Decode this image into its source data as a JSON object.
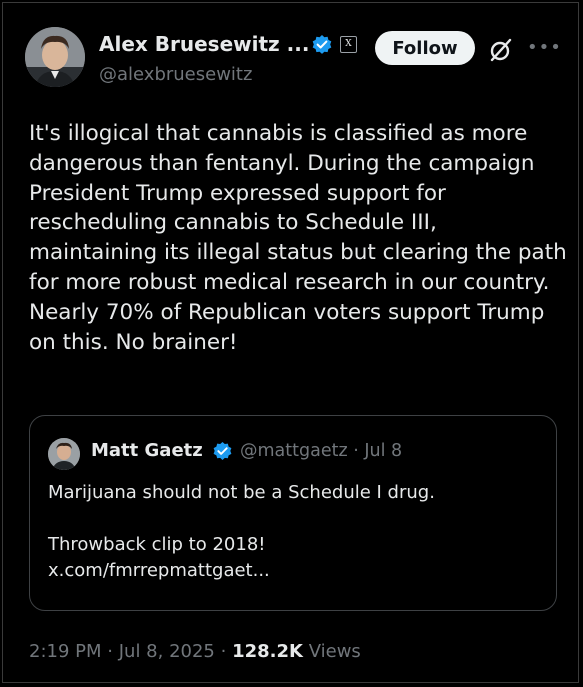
{
  "author": {
    "name": "Alex Bruesewitz ...",
    "handle": "@alexbruesewitz",
    "affiliate_badge": "X"
  },
  "actions": {
    "follow_label": "Follow",
    "more_label": "•••"
  },
  "post": {
    "text": "It's illogical that cannabis is classified as more dangerous than fentanyl. During the campaign President Trump expressed support for rescheduling cannabis to Schedule III, maintaining its illegal status but clearing the path for more robust medical research in our country. Nearly 70% of Republican voters support Trump on this. No brainer!"
  },
  "quote": {
    "name": "Matt Gaetz",
    "handle": "@mattgaetz",
    "separator": "·",
    "date": "Jul 8",
    "line1": "Marijuana should not be a Schedule I drug.",
    "line2": "Throwback clip to 2018!",
    "link": "x.com/fmrrepmattgaet..."
  },
  "footer": {
    "time": "2:19 PM",
    "separator": "·",
    "date": "Jul 8, 2025",
    "views_count": "128.2K",
    "views_label": "Views"
  },
  "colors": {
    "background": "#000000",
    "text_primary": "#e7e9ea",
    "text_secondary": "#71767b",
    "verified_blue": "#1d9bf0",
    "follow_bg": "#eff3f4",
    "border": "#3e4144"
  },
  "icons": [
    "verified-badge-icon",
    "affiliate-x-icon",
    "grok-icon",
    "more-icon"
  ]
}
